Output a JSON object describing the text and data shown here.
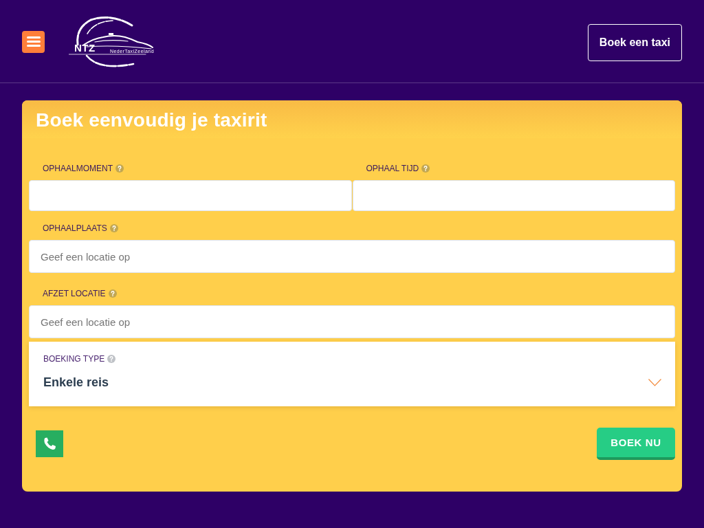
{
  "header": {
    "logo": {
      "initials": "NTZ",
      "name": "NederTaxiZeeland"
    },
    "cta_button": "Boek een taxi"
  },
  "booking_form": {
    "title": "Boek eenvoudig je taxirit",
    "rows": [
      [
        {
          "kind": "date",
          "label": "OPHAALMOMENT"
        },
        {
          "kind": "time",
          "label": "OPHAAL TIJD"
        }
      ],
      [
        {
          "kind": "location",
          "label": "OPHAALPLAATS",
          "placeholder": "Geef een locatie op"
        }
      ],
      [
        {
          "kind": "location",
          "label": "AFZET LOCATIE",
          "placeholder": "Geef een locatie op"
        }
      ]
    ],
    "booking_type": {
      "label": "BOEKING TYPE",
      "value": "Enkele reis"
    },
    "submit_button": "BOEK NU"
  }
}
